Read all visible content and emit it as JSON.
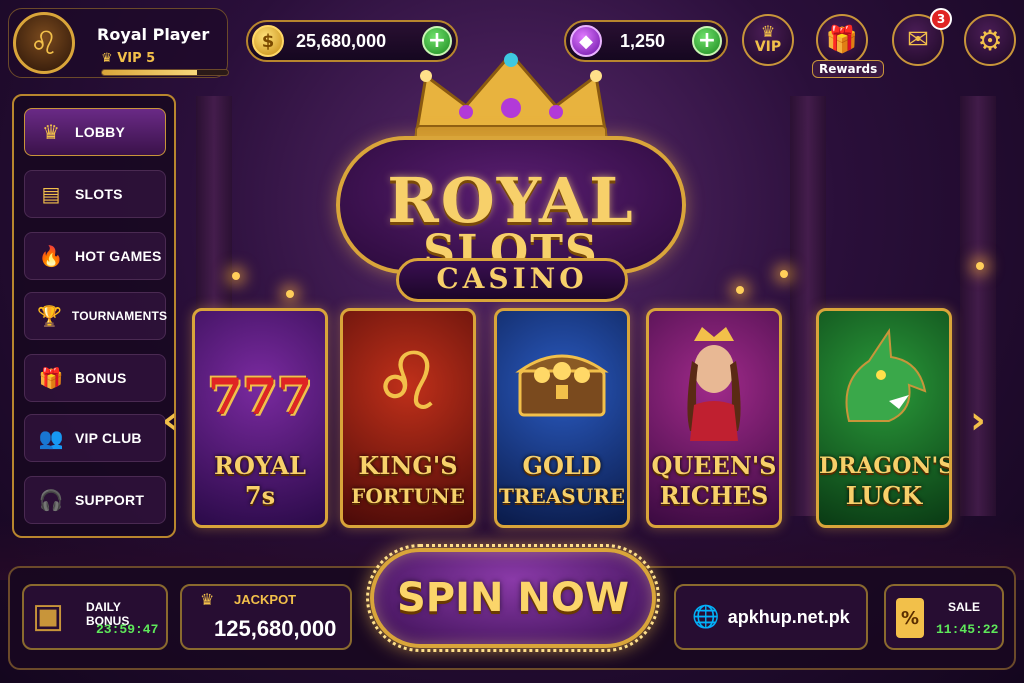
{
  "player": {
    "name": "Royal Player",
    "vip_label": "VIP 5",
    "xp_progress": 0.75
  },
  "currency": {
    "coins": "25,680,000",
    "gems": "1,250"
  },
  "header_buttons": {
    "vip_label": "VIP",
    "rewards_label": "Rewards",
    "mail_badge": "3"
  },
  "sidebar": {
    "items": [
      {
        "label": "LOBBY",
        "icon": "crown-icon"
      },
      {
        "label": "SLOTS",
        "icon": "slot-machine-icon"
      },
      {
        "label": "HOT GAMES",
        "icon": "flame-icon"
      },
      {
        "label": "TOURNAMENTS",
        "icon": "trophy-icon"
      },
      {
        "label": "BONUS",
        "icon": "gift-icon"
      },
      {
        "label": "VIP CLUB",
        "icon": "users-icon"
      },
      {
        "label": "SUPPORT",
        "icon": "headset-icon"
      }
    ]
  },
  "logo": {
    "line1": "ROYAL",
    "line2": "SLOTS",
    "line3": "CASINO"
  },
  "games": [
    {
      "line1": "ROYAL",
      "line2": "7s",
      "art_text": "777"
    },
    {
      "line1": "KING'S",
      "line2": "FORTUNE"
    },
    {
      "line1": "GOLD",
      "line2": "TREASURE"
    },
    {
      "line1": "QUEEN'S",
      "line2": "RICHES"
    },
    {
      "line1": "DRAGON'S",
      "line2": "LUCK"
    }
  ],
  "bottom": {
    "daily_bonus_label": "DAILY BONUS",
    "daily_bonus_timer": "23:59:47",
    "jackpot_label": "JACKPOT",
    "jackpot_value": "125,680,000",
    "spin_label": "SPIN NOW",
    "site": "apkhup.net.pk",
    "sale_label": "SALE",
    "sale_timer": "11:45:22"
  },
  "colors": {
    "gold": "#d9a53a",
    "purple": "#3a0f52",
    "green": "#5ee85a"
  }
}
